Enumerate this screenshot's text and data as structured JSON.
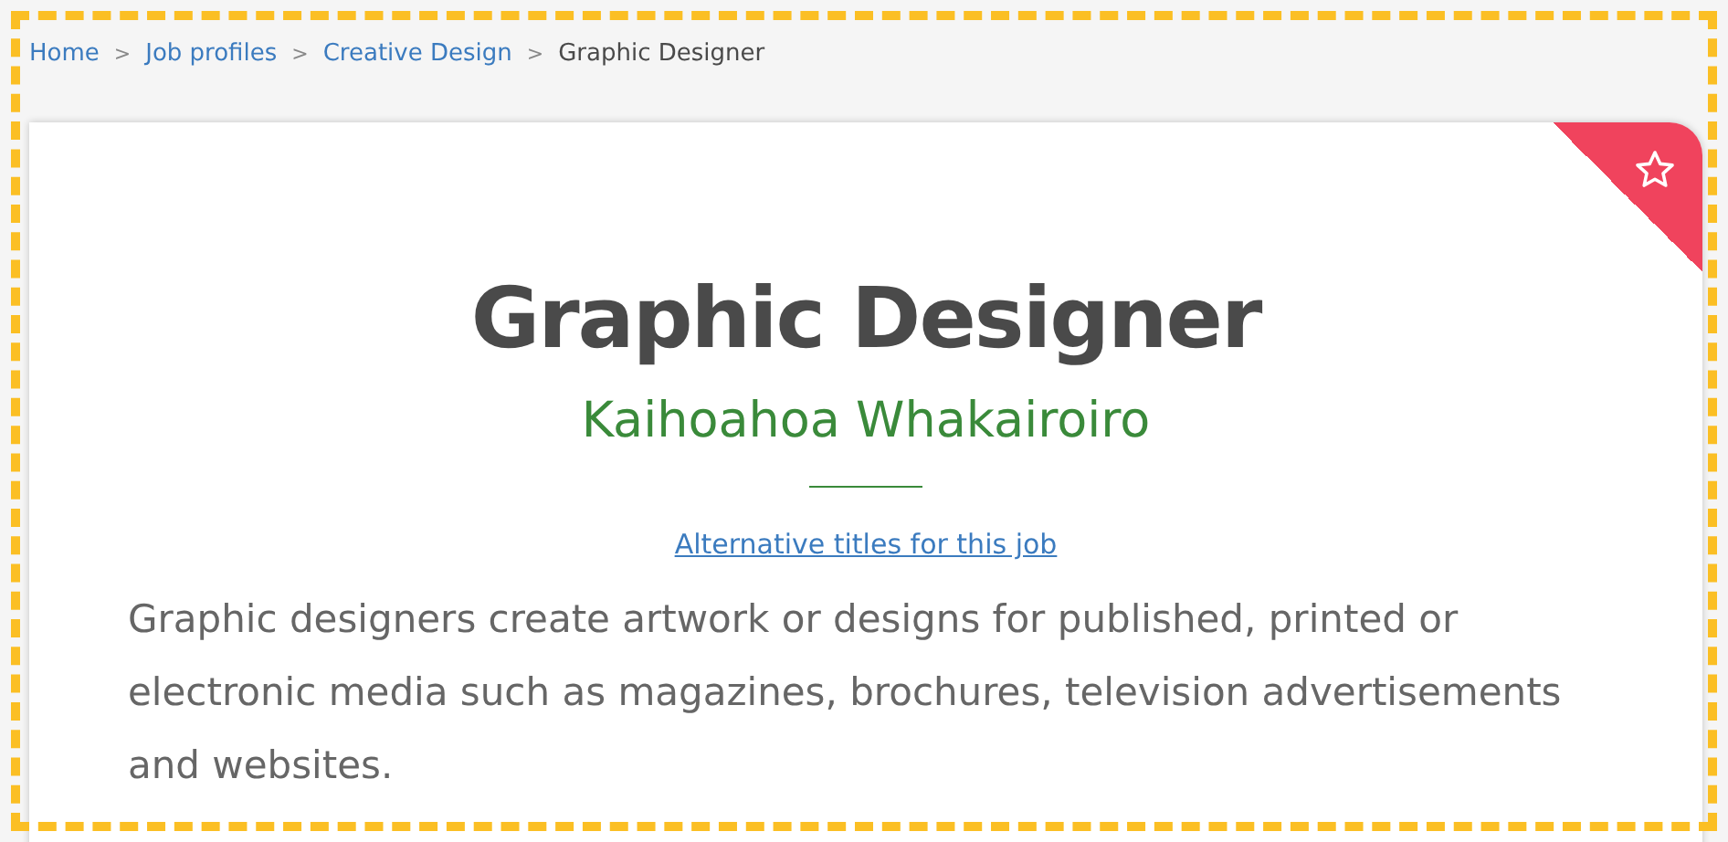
{
  "breadcrumb": [
    {
      "label": "Home",
      "kind": "link"
    },
    {
      "label": "Job profiles",
      "kind": "link"
    },
    {
      "label": "Creative Design",
      "kind": "link"
    },
    {
      "label": "Graphic Designer",
      "kind": "current"
    }
  ],
  "breadcrumb_separator": ">",
  "card": {
    "favourite": false,
    "title": "Graphic Designer",
    "subtitle": "Kaihoahoa Whakairoiro",
    "alt_titles_link": "Alternative titles for this job",
    "description": "Graphic designers create artwork or designs for published, printed or electronic media such as magazines, brochures, television advertisements and websites."
  }
}
